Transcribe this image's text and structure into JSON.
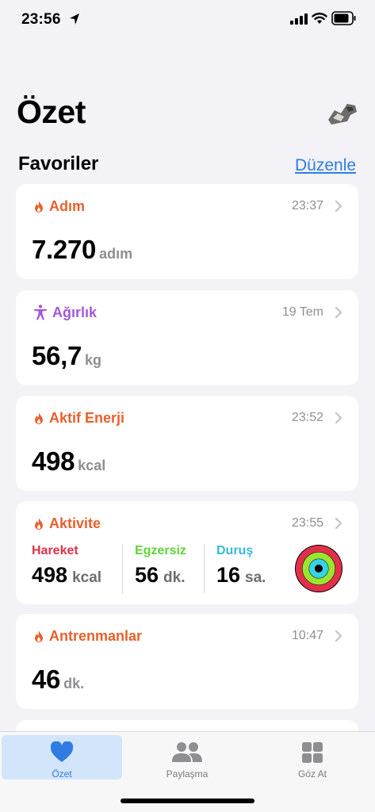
{
  "status_bar": {
    "time": "23:56"
  },
  "header": {
    "title": "Özet"
  },
  "favorites": {
    "title": "Favoriler",
    "edit_label": "Düzenle"
  },
  "cards": [
    {
      "label": "Adım",
      "time": "23:37",
      "value": "7.270",
      "unit": "adım",
      "color": "#e8602c"
    },
    {
      "label": "Ağırlık",
      "time": "19 Tem",
      "value": "56,7",
      "unit": "kg",
      "color": "#a259d9"
    },
    {
      "label": "Aktif Enerji",
      "time": "23:52",
      "value": "498",
      "unit": "kcal",
      "color": "#e8602c"
    },
    {
      "label": "Antrenmanlar",
      "time": "10:47",
      "value": "46",
      "unit": "dk.",
      "color": "#e8602c"
    }
  ],
  "activity": {
    "label": "Aktivite",
    "time": "23:55",
    "color": "#e8602c",
    "move": {
      "label": "Hareket",
      "value": "498",
      "unit": "kcal",
      "color": "#e2304a"
    },
    "exercise": {
      "label": "Egzersiz",
      "value": "56",
      "unit": "dk.",
      "color": "#5fd33a"
    },
    "stand": {
      "label": "Duruş",
      "value": "16",
      "unit": "sa.",
      "color": "#36b9d8"
    }
  },
  "tab_bar": {
    "tabs": [
      {
        "label": "Özet",
        "icon": "heart-icon",
        "active": true
      },
      {
        "label": "Paylaşma",
        "icon": "people-icon",
        "active": false
      },
      {
        "label": "Göz At",
        "icon": "grid-icon",
        "active": false
      }
    ],
    "accent": "#2f7de1"
  }
}
